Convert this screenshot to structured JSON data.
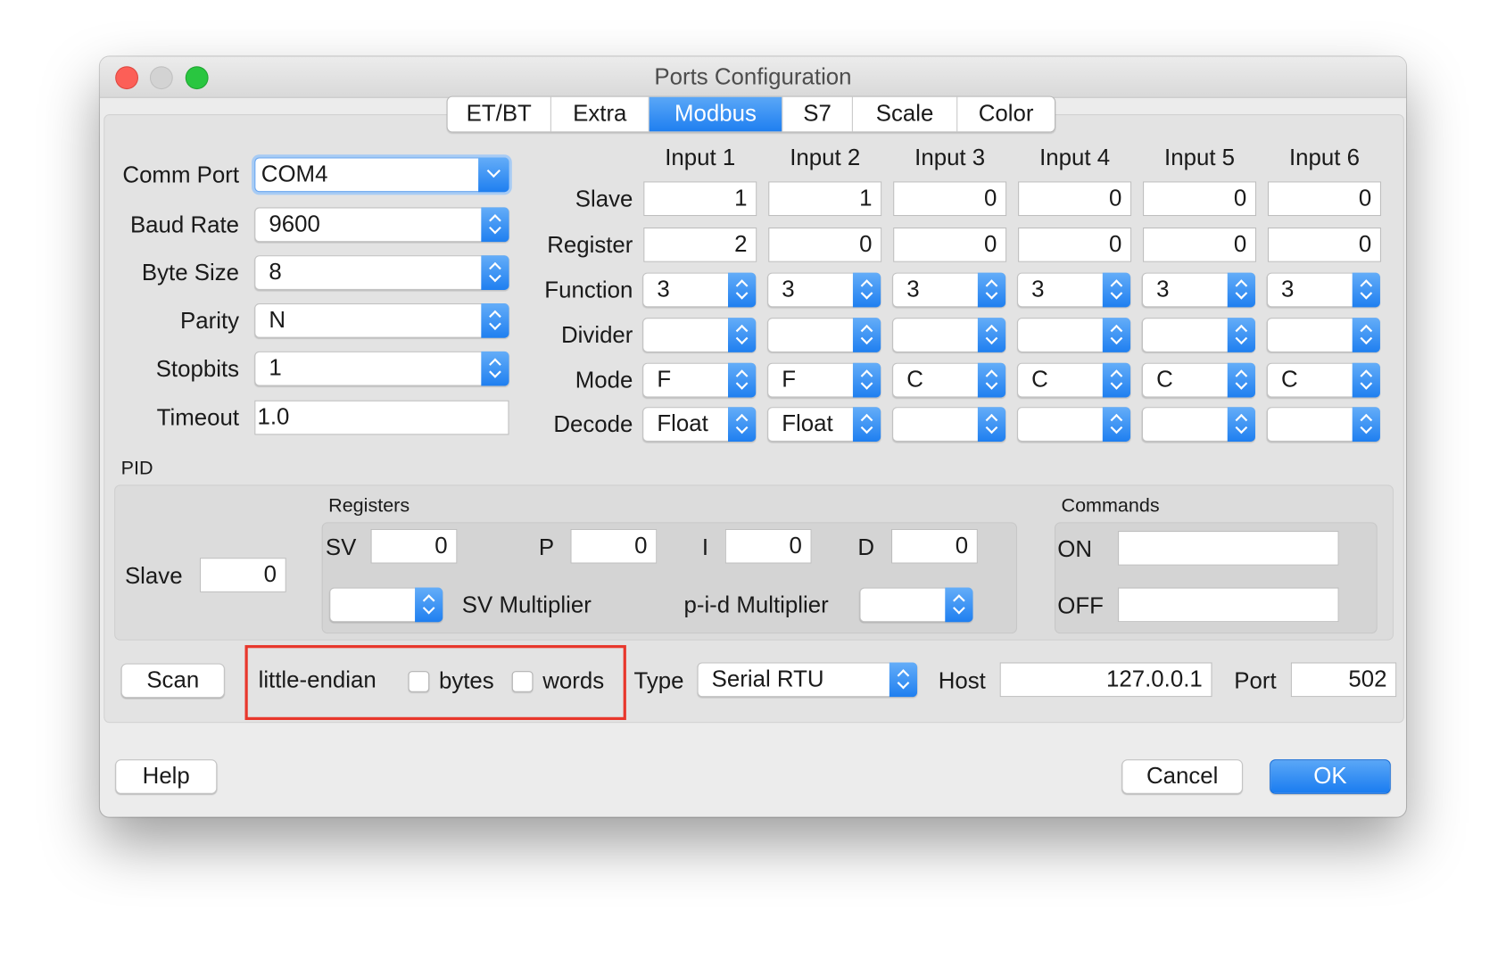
{
  "window": {
    "title": "Ports Configuration"
  },
  "tabs": [
    "ET/BT",
    "Extra",
    "Modbus",
    "S7",
    "Scale",
    "Color"
  ],
  "active_tab": "Modbus",
  "serial": {
    "comm_port_label": "Comm Port",
    "comm_port": "COM4",
    "baud_rate_label": "Baud Rate",
    "baud_rate": "9600",
    "byte_size_label": "Byte Size",
    "byte_size": "8",
    "parity_label": "Parity",
    "parity": "N",
    "stopbits_label": "Stopbits",
    "stopbits": "1",
    "timeout_label": "Timeout",
    "timeout": "1.0"
  },
  "inputs": {
    "headers": [
      "Input 1",
      "Input 2",
      "Input 3",
      "Input 4",
      "Input 5",
      "Input 6"
    ],
    "row_labels": {
      "slave": "Slave",
      "register": "Register",
      "function": "Function",
      "divider": "Divider",
      "mode": "Mode",
      "decode": "Decode"
    },
    "slave": [
      "1",
      "1",
      "0",
      "0",
      "0",
      "0"
    ],
    "register": [
      "2",
      "0",
      "0",
      "0",
      "0",
      "0"
    ],
    "function": [
      "3",
      "3",
      "3",
      "3",
      "3",
      "3"
    ],
    "divider": [
      "",
      "",
      "",
      "",
      "",
      ""
    ],
    "mode": [
      "F",
      "F",
      "C",
      "C",
      "C",
      "C"
    ],
    "decode": [
      "Float",
      "Float",
      "",
      "",
      "",
      ""
    ]
  },
  "pid": {
    "title": "PID",
    "slave_label": "Slave",
    "slave": "0",
    "registers_title": "Registers",
    "sv_label": "SV",
    "sv": "0",
    "p_label": "P",
    "p": "0",
    "i_label": "I",
    "i": "0",
    "d_label": "D",
    "d": "0",
    "sv_multiplier_label": "SV Multiplier",
    "sv_multiplier": "",
    "pid_multiplier_label": "p-i-d Multiplier",
    "pid_multiplier": "",
    "commands_title": "Commands",
    "on_label": "ON",
    "on": "",
    "off_label": "OFF",
    "off": ""
  },
  "bottom": {
    "scan": "Scan",
    "little_endian": "little-endian",
    "bytes": "bytes",
    "bytes_checked": false,
    "words": "words",
    "words_checked": false,
    "type_label": "Type",
    "type": "Serial RTU",
    "host_label": "Host",
    "host": "127.0.0.1",
    "port_label": "Port",
    "port": "502"
  },
  "footer": {
    "help": "Help",
    "cancel": "Cancel",
    "ok": "OK"
  },
  "colors": {
    "accent": "#1f7ff0",
    "highlight": "#e8372c"
  }
}
